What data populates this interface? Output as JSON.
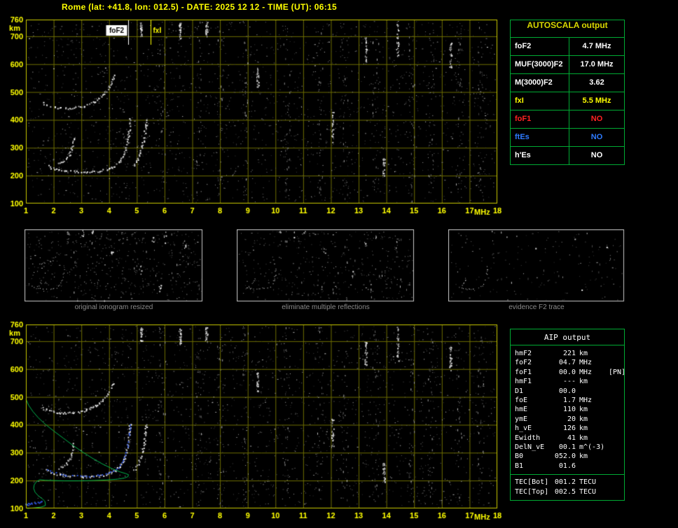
{
  "title": "Rome (lat: +41.8, lon: 012.5) - DATE: 2025 12 12 - TIME (UT): 06:15",
  "colors": {
    "background": "#000000",
    "axis_text": "#ffff00",
    "grid": "#6e6e00",
    "plot_border": "#c8c800",
    "table_green": "#00aa33",
    "table_header_yellow": "#d8d800",
    "trace_white": "#ffffff",
    "profile_green": "#00b44c",
    "scaled_points_blue": "#2e55e0",
    "caption_gray": "#8a8a8a",
    "marker_fof2": "#ffffff",
    "marker_fxi": "#ffff00",
    "no_red": "#ff2222",
    "no_blue": "#2e7bff"
  },
  "autoscala": {
    "title": "AUTOSCALA output",
    "rows": [
      {
        "label": "foF2",
        "value": "4.7 MHz",
        "color": "#ffffff"
      },
      {
        "label": "MUF(3000)F2",
        "value": "17.0 MHz",
        "color": "#ffffff"
      },
      {
        "label": "M(3000)F2",
        "value": "3.62",
        "color": "#ffffff"
      },
      {
        "label": "fxI",
        "value": "5.5 MHz",
        "color": "#ffff00"
      },
      {
        "label": "foF1",
        "value": "NO",
        "color": "#ff2222"
      },
      {
        "label": "ftEs",
        "value": "NO",
        "color": "#2e7bff"
      },
      {
        "label": "h'Es",
        "value": "NO",
        "color": "#ffffff"
      }
    ]
  },
  "aip": {
    "title": "AIP output",
    "rows": [
      {
        "label": "hmF2",
        "value": "221",
        "unit": "km"
      },
      {
        "label": "foF2",
        "value": "04.7",
        "unit": "MHz"
      },
      {
        "label": "foF1",
        "value": "00.0",
        "unit": "MHz",
        "note": "[PN]"
      },
      {
        "label": "hmF1",
        "value": "---",
        "unit": "km"
      },
      {
        "label": "D1",
        "value": "00.0",
        "unit": ""
      },
      {
        "label": "foE",
        "value": "1.7",
        "unit": "MHz"
      },
      {
        "label": "hmE",
        "value": "110",
        "unit": "km"
      },
      {
        "label": "ymE",
        "value": "20",
        "unit": "km"
      },
      {
        "label": "h_vE",
        "value": "126",
        "unit": "km"
      },
      {
        "label": "Ewidth",
        "value": "41",
        "unit": "km"
      },
      {
        "label": "DelN_vE",
        "value": "00.1",
        "unit": "m^(-3)"
      },
      {
        "label": "B0",
        "value": "052.0",
        "unit": "km"
      },
      {
        "label": "B1",
        "value": "01.6",
        "unit": ""
      },
      {
        "label": "TEC[Bot]",
        "value": "001.2",
        "unit": "TECU",
        "sep": true
      },
      {
        "label": "TEC[Top]",
        "value": "002.5",
        "unit": "TECU"
      }
    ]
  },
  "panels": [
    {
      "caption": "original ionogram resized"
    },
    {
      "caption": "eliminate multiple reflections"
    },
    {
      "caption": "evidence F2 trace"
    }
  ],
  "chart_data": [
    {
      "id": "main_ionogram",
      "type": "scatter",
      "title": "raw ionogram with scaled characteristics",
      "xlabel": "MHz",
      "ylabel": "km",
      "xlim": [
        1,
        18
      ],
      "ylim": [
        100,
        760
      ],
      "xticks": [
        1,
        2,
        3,
        4,
        5,
        6,
        7,
        8,
        9,
        10,
        11,
        12,
        13,
        14,
        15,
        16,
        17,
        18
      ],
      "yticks": [
        760,
        700,
        600,
        500,
        400,
        300,
        200,
        100
      ],
      "grid": true,
      "markers": [
        {
          "label": "foF2",
          "f": 4.7,
          "value_mhz": 4.7,
          "style": "box-white"
        },
        {
          "label": "fxI",
          "f": 5.5,
          "value_mhz": 5.5,
          "style": "text-yellow"
        }
      ],
      "traces": {
        "f2": [
          [
            1.75,
            238
          ],
          [
            1.9,
            230
          ],
          [
            2.1,
            224
          ],
          [
            2.4,
            219
          ],
          [
            2.8,
            216
          ],
          [
            3.2,
            215
          ],
          [
            3.6,
            218
          ],
          [
            3.9,
            224
          ],
          [
            4.15,
            234
          ],
          [
            4.35,
            250
          ],
          [
            4.5,
            272
          ],
          [
            4.6,
            300
          ],
          [
            4.67,
            335
          ],
          [
            4.72,
            375
          ],
          [
            4.75,
            410
          ]
        ],
        "f2_second_hop": [
          [
            1.6,
            462
          ],
          [
            1.8,
            452
          ],
          [
            2.1,
            446
          ],
          [
            2.45,
            443
          ],
          [
            2.8,
            445
          ],
          [
            3.1,
            452
          ],
          [
            3.4,
            464
          ],
          [
            3.65,
            480
          ],
          [
            3.85,
            500
          ],
          [
            4.0,
            522
          ],
          [
            4.1,
            545
          ],
          [
            4.18,
            565
          ]
        ],
        "cusp": [
          [
            2.15,
            243
          ],
          [
            2.3,
            250
          ],
          [
            2.45,
            262
          ],
          [
            2.55,
            278
          ],
          [
            2.63,
            298
          ],
          [
            2.68,
            320
          ],
          [
            2.7,
            338
          ]
        ],
        "x_mode": [
          [
            4.9,
            240
          ],
          [
            5.05,
            265
          ],
          [
            5.15,
            295
          ],
          [
            5.25,
            335
          ],
          [
            5.3,
            375
          ],
          [
            5.35,
            410
          ]
        ]
      },
      "streaks": [
        {
          "f": 5.15,
          "h1": 700,
          "h2": 750
        },
        {
          "f": 6.55,
          "h1": 690,
          "h2": 755
        },
        {
          "f": 7.5,
          "h1": 700,
          "h2": 752
        },
        {
          "f": 9.35,
          "h1": 520,
          "h2": 590
        },
        {
          "f": 12.05,
          "h1": 320,
          "h2": 430
        },
        {
          "f": 13.25,
          "h1": 610,
          "h2": 700
        },
        {
          "f": 13.9,
          "h1": 195,
          "h2": 265
        },
        {
          "f": 14.4,
          "h1": 630,
          "h2": 752
        },
        {
          "f": 16.3,
          "h1": 590,
          "h2": 680
        }
      ],
      "rfi_bands": [
        5.9,
        7.2,
        8.0,
        8.9,
        10.4,
        11.6,
        12.5,
        13.6,
        14.9,
        15.6,
        16.6,
        17.4
      ]
    },
    {
      "id": "profile_ionogram",
      "type": "scatter",
      "title": "ionogram with restored trace (blue) and electron density profile (green)",
      "xlabel": "MHz",
      "ylabel": "km",
      "xlim": [
        1,
        18
      ],
      "ylim": [
        100,
        760
      ],
      "xticks": [
        1,
        2,
        3,
        4,
        5,
        6,
        7,
        8,
        9,
        10,
        11,
        12,
        13,
        14,
        15,
        16,
        17,
        18
      ],
      "yticks": [
        760,
        700,
        600,
        500,
        400,
        300,
        200,
        100
      ],
      "grid": true,
      "traces_ref": "main_ionogram",
      "profile_green": [
        [
          1.0,
          492
        ],
        [
          1.1,
          470
        ],
        [
          1.25,
          448
        ],
        [
          1.45,
          425
        ],
        [
          1.7,
          402
        ],
        [
          2.0,
          378
        ],
        [
          2.35,
          352
        ],
        [
          2.7,
          326
        ],
        [
          3.05,
          302
        ],
        [
          3.4,
          280
        ],
        [
          3.75,
          260
        ],
        [
          4.1,
          243
        ],
        [
          4.4,
          231
        ],
        [
          4.6,
          225
        ],
        [
          4.7,
          221
        ],
        [
          4.68,
          214
        ],
        [
          4.55,
          209
        ],
        [
          4.3,
          205
        ],
        [
          3.9,
          202
        ],
        [
          3.4,
          200
        ],
        [
          2.9,
          199
        ],
        [
          2.4,
          199
        ],
        [
          2.0,
          200
        ],
        [
          1.7,
          201
        ],
        [
          1.5,
          203
        ],
        [
          1.38,
          196
        ],
        [
          1.3,
          185
        ],
        [
          1.28,
          172
        ],
        [
          1.33,
          158
        ],
        [
          1.45,
          145
        ],
        [
          1.6,
          134
        ],
        [
          1.68,
          126
        ],
        [
          1.7,
          118
        ],
        [
          1.7,
          110
        ],
        [
          1.55,
          105
        ],
        [
          1.3,
          102
        ],
        [
          1.05,
          100
        ]
      ],
      "scaled_e_points": [
        [
          0.98,
          118
        ],
        [
          1.02,
          116
        ],
        [
          1.08,
          120
        ],
        [
          1.18,
          121
        ],
        [
          1.3,
          122
        ],
        [
          1.42,
          124
        ],
        [
          1.55,
          127
        ]
      ]
    }
  ]
}
